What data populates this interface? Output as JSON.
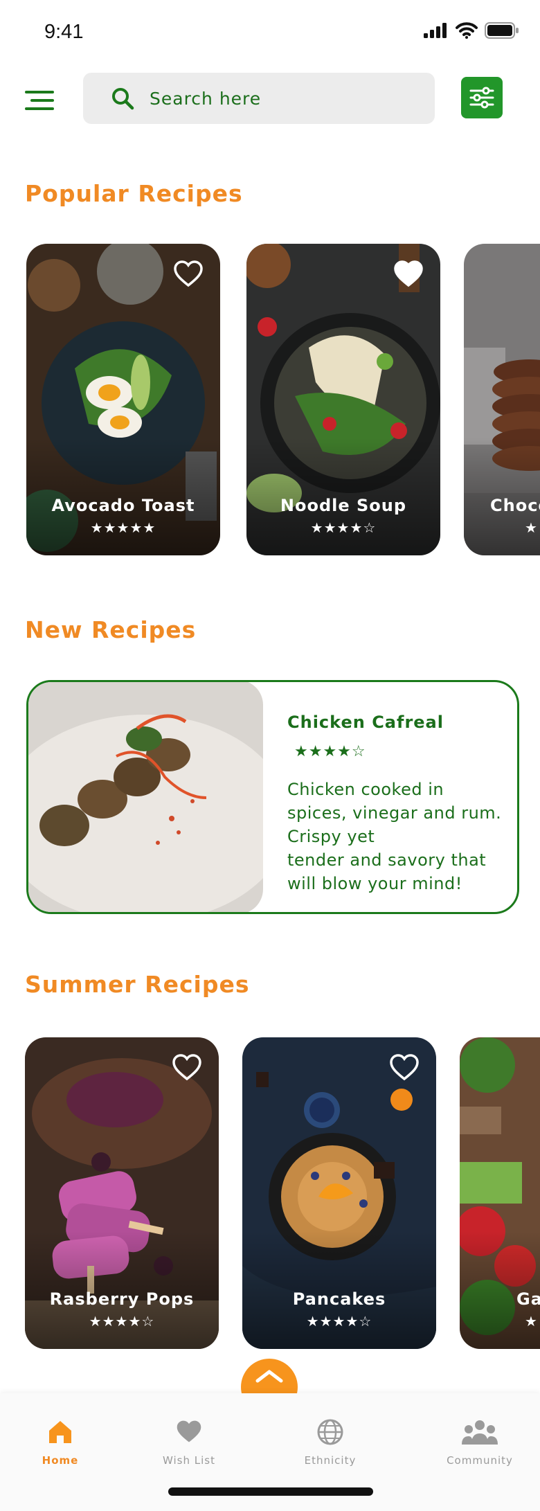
{
  "status": {
    "time": "9:41",
    "icons": [
      "cellular-signal-icon",
      "wifi-icon",
      "battery-icon"
    ]
  },
  "header": {
    "menu_icon": "hamburger-menu-icon",
    "search_placeholder": "Search here",
    "search_icon": "search-icon",
    "filter_icon": "sliders-icon"
  },
  "colors": {
    "accent_orange": "#f08a24",
    "brand_green": "#1b7a1b",
    "filter_green": "#22962a",
    "nav_inactive": "#9a9a9a"
  },
  "popular": {
    "title": "Popular Recipes",
    "items": [
      {
        "name": "Avocado Toast",
        "stars": "★★★★★",
        "rating": 5,
        "favorited": false
      },
      {
        "name": "Noodle Soup",
        "stars": "★★★★☆",
        "rating": 4,
        "favorited": true
      },
      {
        "name": "Choco",
        "stars": "★",
        "rating": null,
        "favorited": null
      }
    ]
  },
  "new_recipes": {
    "title": "New Recipes",
    "item": {
      "name": "Chicken Cafreal",
      "stars": "★★★★☆",
      "rating": 4,
      "description": "Chicken cooked in\nspices, vinegar and rum.\nCrispy yet\ntender and savory that\nwill blow your mind!"
    }
  },
  "summer": {
    "title": "Summer Recipes",
    "items": [
      {
        "name": "Rasberry Pops",
        "stars": "★★★★☆",
        "rating": 4,
        "favorited": false
      },
      {
        "name": "Pancakes",
        "stars": "★★★★☆",
        "rating": 4,
        "favorited": false
      },
      {
        "name": "Ga",
        "stars": "★",
        "rating": null,
        "favorited": null
      }
    ]
  },
  "scroll_up_icon": "chevron-up-icon",
  "bottom_nav": {
    "items": [
      {
        "label": "Home",
        "icon": "home-icon",
        "active": true
      },
      {
        "label": "Wish List",
        "icon": "heart-icon",
        "active": false
      },
      {
        "label": "Ethnicity",
        "icon": "globe-icon",
        "active": false
      },
      {
        "label": "Community",
        "icon": "community-icon",
        "active": false
      }
    ]
  }
}
